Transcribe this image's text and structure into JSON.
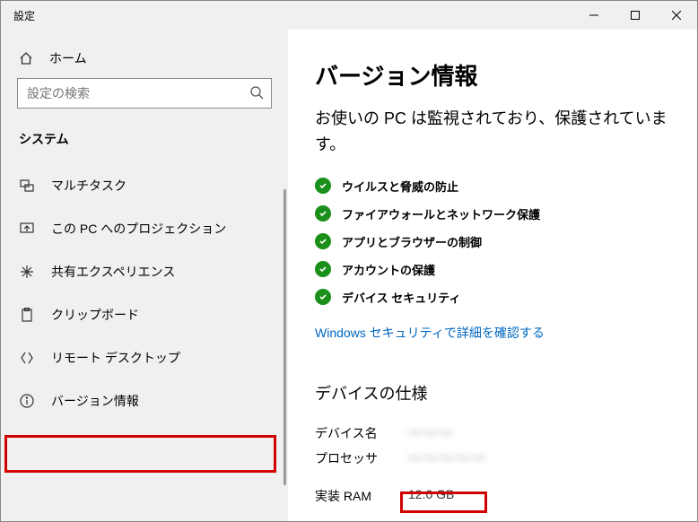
{
  "window": {
    "title": "設定"
  },
  "sidebar": {
    "home_label": "ホーム",
    "search_placeholder": "設定の検索",
    "section_label": "システム",
    "items": [
      {
        "label": "マルチタスク"
      },
      {
        "label": "この PC へのプロジェクション"
      },
      {
        "label": "共有エクスペリエンス"
      },
      {
        "label": "クリップボード"
      },
      {
        "label": "リモート デスクトップ"
      },
      {
        "label": "バージョン情報"
      }
    ]
  },
  "main": {
    "title": "バージョン情報",
    "subtitle": "お使いの PC は監視されており、保護されています。",
    "security_items": [
      "ウイルスと脅威の防止",
      "ファイアウォールとネットワーク保護",
      "アプリとブラウザーの制御",
      "アカウントの保護",
      "デバイス セキュリティ"
    ],
    "security_link": "Windows セキュリティで詳細を確認する",
    "device_spec_heading": "デバイスの仕様",
    "spec_rows": {
      "device_name_label": "デバイス名",
      "device_name_value": "— — —",
      "processor_label": "プロセッサ",
      "processor_value": "— — — — —",
      "ram_label": "実装 RAM",
      "ram_value": "12.0 GB"
    }
  }
}
